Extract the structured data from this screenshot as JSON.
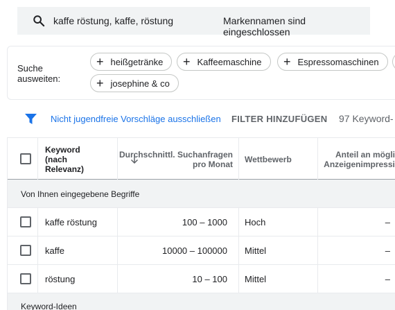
{
  "search": {
    "query": "kaffe röstung, kaffe, röstung",
    "note": "Markennamen sind eingeschlossen"
  },
  "expand": {
    "label_line1": "Suche",
    "label_line2": "ausweiten:",
    "chips": [
      "heißgetränke",
      "Kaffeemaschine",
      "Espressomaschinen",
      "josephine & co"
    ]
  },
  "filter": {
    "exclude_link": "Nicht jugendfreie Vorschläge ausschließen",
    "add_filter": "FILTER HINZUFÜGEN",
    "count": "97 Keyword-"
  },
  "table": {
    "headers": {
      "keyword_line1": "Keyword",
      "keyword_line2": "(nach",
      "keyword_line3": "Relevanz)",
      "searches_line1": "Durchschnittl. Suchanfragen",
      "searches_line2": "pro Monat",
      "competition": "Wettbewerb",
      "share_line1": "Anteil an mögli",
      "share_line2": "Anzeigenimpressi"
    },
    "group1": "Von Ihnen eingegebene Begriffe",
    "rows": [
      {
        "keyword": "kaffe röstung",
        "searches": "100 – 1000",
        "competition": "Hoch",
        "share": "–"
      },
      {
        "keyword": "kaffe",
        "searches": "10000 – 100000",
        "competition": "Mittel",
        "share": "–"
      },
      {
        "keyword": "röstung",
        "searches": "10 – 100",
        "competition": "Mittel",
        "share": "–"
      }
    ],
    "group2": "Keyword-Ideen"
  },
  "colors": {
    "accent": "#1a73e8",
    "search_bg": "#f1f3f4",
    "group_bg": "#f1f3f4"
  },
  "icons": {
    "search": "search-icon",
    "filter": "filter-icon",
    "sort": "arrow-down-icon",
    "add": "plus-icon"
  }
}
